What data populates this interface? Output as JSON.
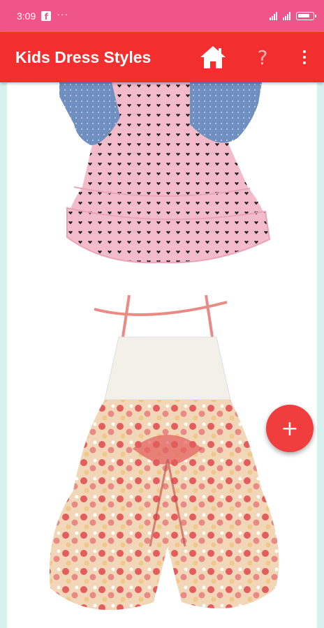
{
  "status_bar": {
    "time": "3:09",
    "notification_dots": "···"
  },
  "app_bar": {
    "title": "Kids Dress Styles",
    "home_icon": "home-icon",
    "help_icon": "help-icon",
    "help_symbol": "?",
    "menu_icon": "overflow-menu-icon"
  },
  "gallery": {
    "items": [
      {
        "subject": "pink polka dot dress with denim bolero",
        "colors": {
          "dress": "#f4bccb",
          "denim": "#6f8fc0"
        }
      },
      {
        "subject": "floral romper with lace bodice",
        "colors": {
          "fabric": "#e98a84",
          "lace": "#f3efe9"
        }
      }
    ]
  },
  "fab": {
    "label": "+",
    "color": "#f03e3e"
  },
  "colors": {
    "status_bar": "#f0558a",
    "app_bar": "#f22e2e",
    "background": "#d7f2ec"
  }
}
